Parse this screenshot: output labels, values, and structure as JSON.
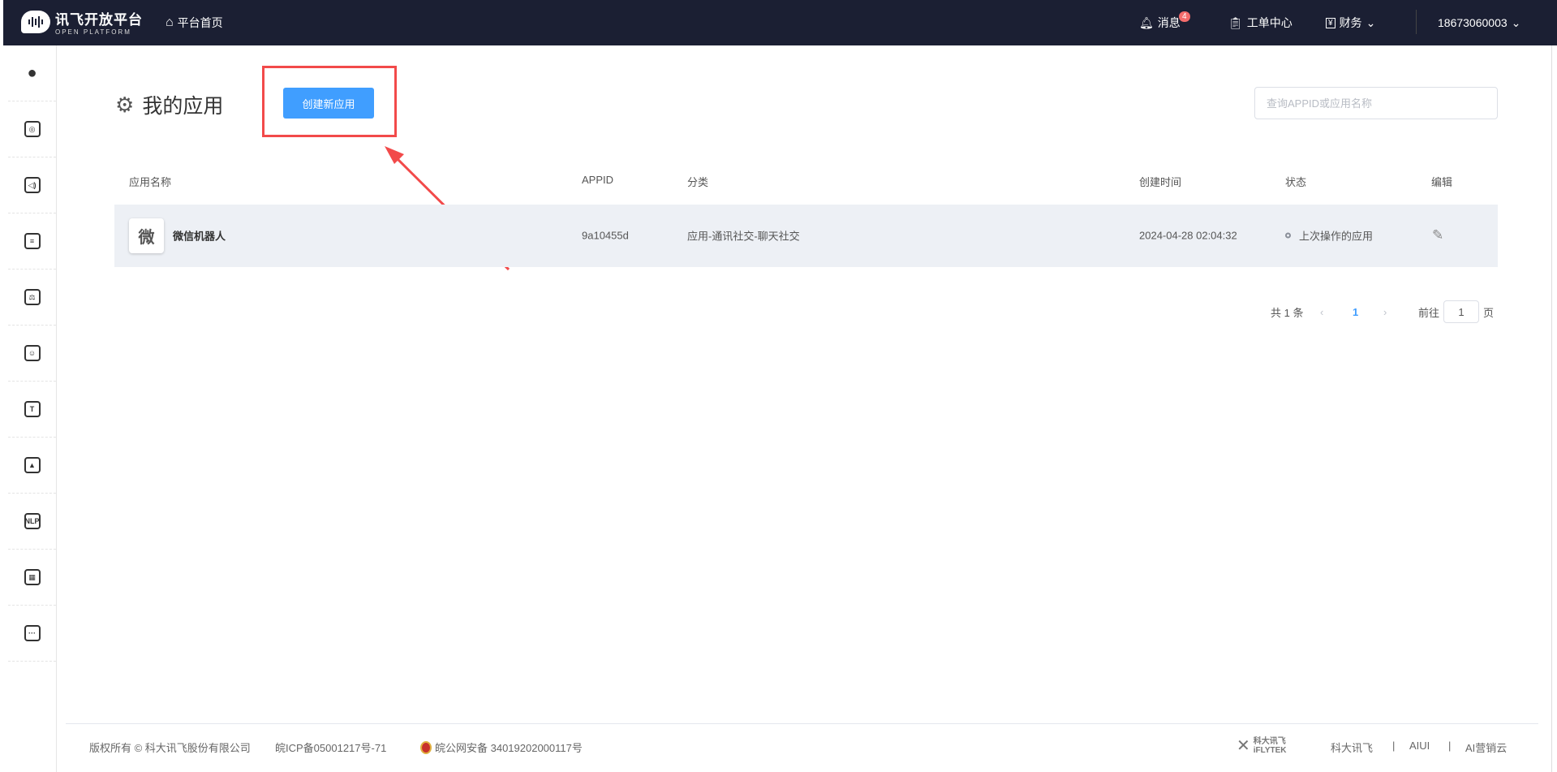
{
  "header": {
    "logo_title": "讯飞开放平台",
    "logo_subtitle": "OPEN PLATFORM",
    "home": "平台首页",
    "messages": "消息",
    "messages_badge": "4",
    "tickets": "工单中心",
    "finance": "财务",
    "user": "18673060003"
  },
  "sidebar": {
    "items": [
      {
        "icon": "flame-icon",
        "glyph": "●"
      },
      {
        "icon": "speech-recognition-icon",
        "glyph": "◎"
      },
      {
        "icon": "speech-synthesis-icon",
        "glyph": "◁)"
      },
      {
        "icon": "voice-print-icon",
        "glyph": "≡"
      },
      {
        "icon": "translation-icon",
        "glyph": "⚖"
      },
      {
        "icon": "face-icon",
        "glyph": "☺"
      },
      {
        "icon": "text-recognition-icon",
        "glyph": "T"
      },
      {
        "icon": "image-icon",
        "glyph": "▲"
      },
      {
        "icon": "nlp-icon",
        "glyph": "NLP"
      },
      {
        "icon": "apps-icon",
        "glyph": "▦"
      },
      {
        "icon": "more-icon",
        "glyph": "···"
      }
    ]
  },
  "main": {
    "title": "我的应用",
    "create_button": "创建新应用",
    "search_placeholder": "查询APPID或应用名称",
    "columns": [
      "应用名称",
      "APPID",
      "分类",
      "创建时间",
      "状态",
      "编辑"
    ],
    "rows": [
      {
        "icon_char": "微",
        "name": "微信机器人",
        "appid": "9a10455d",
        "category": "应用-通讯社交-聊天社交",
        "created": "2024-04-28 02:04:32",
        "status": "上次操作的应用"
      }
    ],
    "pagination": {
      "total": "共 1 条",
      "current": "1",
      "goto_label": "前往",
      "goto_value": "1",
      "page_suffix": "页"
    }
  },
  "footer": {
    "copyright": "版权所有 © 科大讯飞股份有限公司",
    "icp": "皖ICP备05001217号-71",
    "police": "皖公网安备 34019202000117号",
    "brand_logo": "科大讯飞 iFLYTEK",
    "links": [
      "科大讯飞",
      "AIUI",
      "AI营销云"
    ],
    "separator": "|"
  },
  "colors": {
    "header_bg": "#1b1f33",
    "primary": "#409eff",
    "highlight": "#f24a4a",
    "row_bg": "#edf0f5"
  }
}
